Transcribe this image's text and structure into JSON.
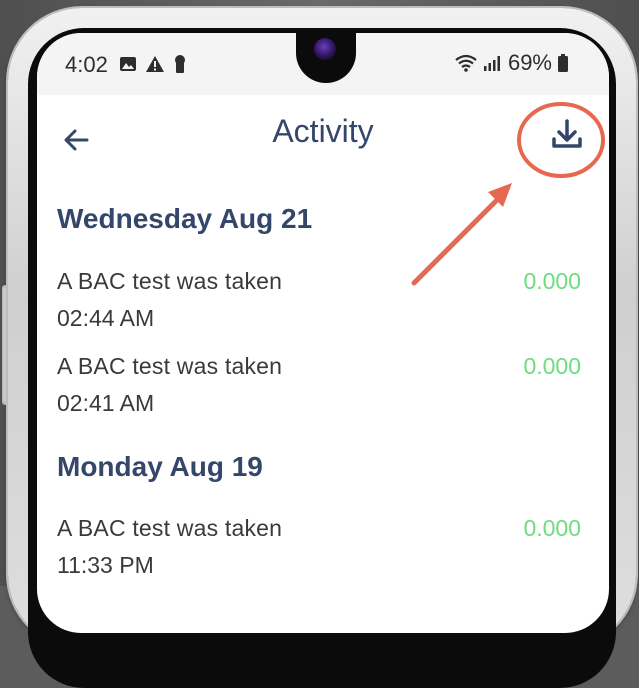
{
  "status_bar": {
    "time": "4:02",
    "battery": "69%",
    "left_icons": [
      "image-icon",
      "warning-icon",
      "keyhole-icon"
    ],
    "right_icons": [
      "wifi-icon",
      "signal-icon",
      "battery-icon"
    ]
  },
  "header": {
    "title": "Activity",
    "back_icon": "arrow-left-icon",
    "download_icon": "download-icon"
  },
  "activity": {
    "days": [
      {
        "heading": "Wednesday Aug 21",
        "entries": [
          {
            "label": "A BAC test was taken",
            "time": "02:44 AM",
            "value": "0.000"
          },
          {
            "label": "A BAC test was taken",
            "time": "02:41 AM",
            "value": "0.000"
          }
        ]
      },
      {
        "heading": "Monday Aug 19",
        "entries": [
          {
            "label": "A BAC test was taken",
            "time": "11:33 PM",
            "value": "0.000"
          }
        ]
      }
    ]
  },
  "colors": {
    "title": "#34476b",
    "value": "#6fdc7e",
    "annotation": "#e8684f"
  }
}
